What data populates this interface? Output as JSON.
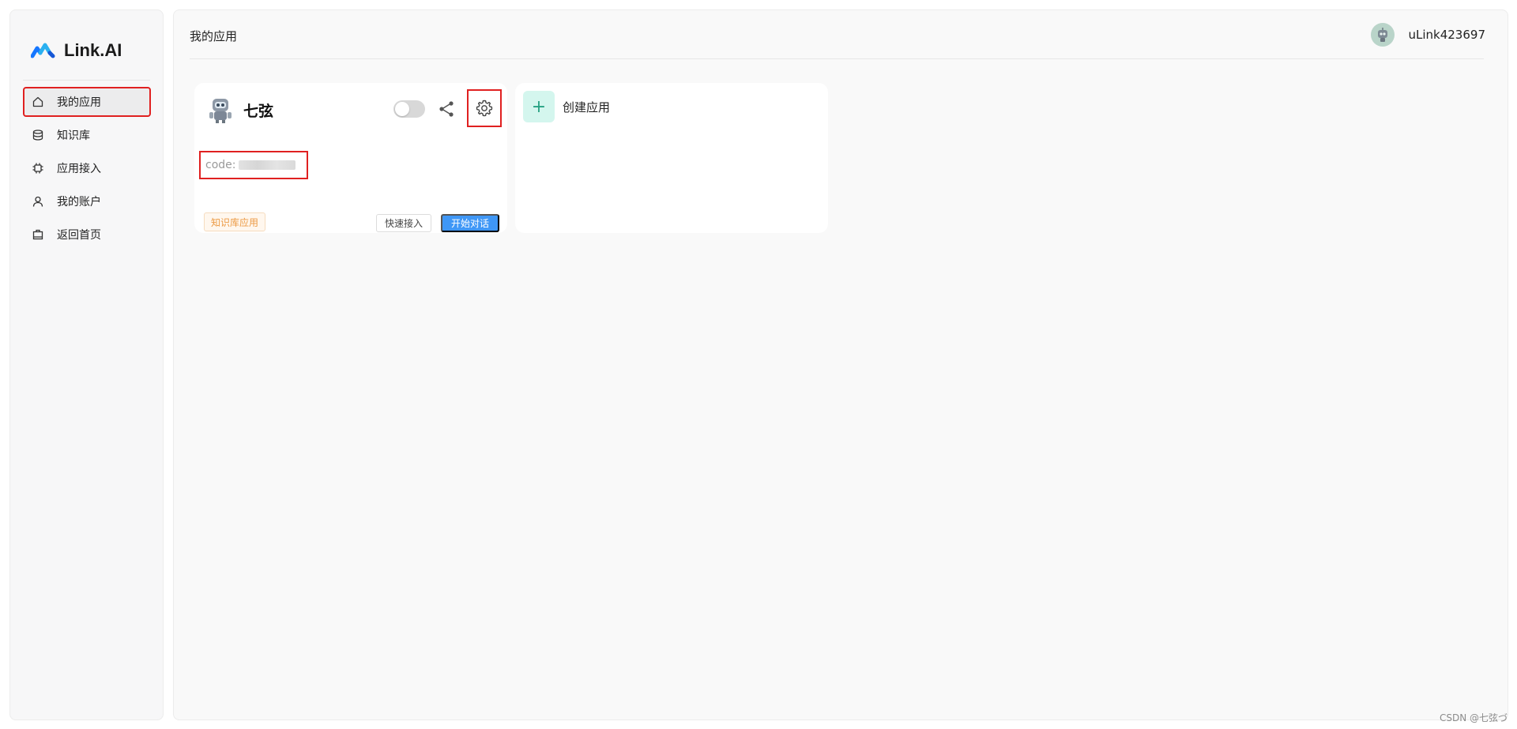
{
  "brand": {
    "name": "Link.AI"
  },
  "sidebar": {
    "items": [
      {
        "label": "我的应用",
        "icon": "home-icon",
        "active": true
      },
      {
        "label": "知识库",
        "icon": "database-icon",
        "active": false
      },
      {
        "label": "应用接入",
        "icon": "chip-icon",
        "active": false
      },
      {
        "label": "我的账户",
        "icon": "user-icon",
        "active": false
      },
      {
        "label": "返回首页",
        "icon": "briefcase-icon",
        "active": false
      }
    ]
  },
  "header": {
    "title": "我的应用",
    "user": {
      "name": "uLink423697",
      "avatar_icon": "robot-avatar-icon"
    }
  },
  "app_card": {
    "name": "七弦",
    "avatar_icon": "robot-avatar-icon",
    "enabled": false,
    "code_label": "code:",
    "tag": "知识库应用",
    "quick_button": "快速接入",
    "chat_button": "开始对话"
  },
  "create_card": {
    "label": "创建应用",
    "icon": "plus-icon"
  },
  "watermark": "CSDN @七弦づ",
  "colors": {
    "accent_blue": "#3f97f6",
    "highlight_red": "#e02020",
    "tag_orange": "#ec9a44",
    "plus_green": "#26a283"
  }
}
